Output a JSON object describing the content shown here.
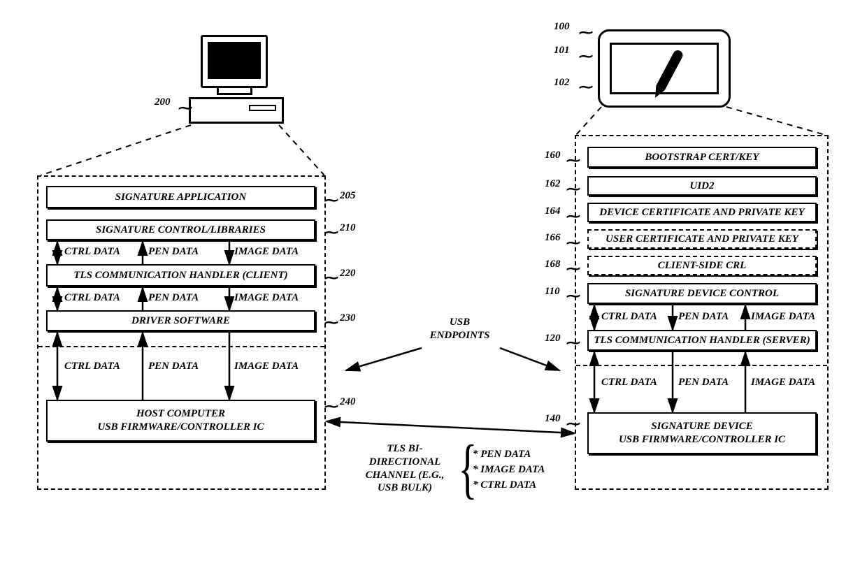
{
  "left": {
    "ref_computer": "200",
    "b205": "SIGNATURE APPLICATION",
    "b210": "SIGNATURE CONTROL/LIBRARIES",
    "b220": "TLS COMMUNICATION HANDLER (CLIENT)",
    "b230": "DRIVER SOFTWARE",
    "b240_l1": "HOST COMPUTER",
    "b240_l2": "USB FIRMWARE/CONTROLLER IC",
    "r205": "205",
    "r210": "210",
    "r220": "220",
    "r230": "230",
    "r240": "240",
    "ctrl": "CTRL DATA",
    "pen": "PEN DATA",
    "image": "IMAGE DATA"
  },
  "right": {
    "ref_tablet": "100",
    "ref_screen": "101",
    "ref_pen": "102",
    "b160": "BOOTSTRAP CERT/KEY",
    "b162": "UID2",
    "b164": "DEVICE CERTIFICATE AND PRIVATE KEY",
    "b166": "USER CERTIFICATE AND PRIVATE KEY",
    "b168": "CLIENT-SIDE CRL",
    "b110": "SIGNATURE DEVICE CONTROL",
    "b120": "TLS COMMUNICATION HANDLER (SERVER)",
    "b140_l1": "SIGNATURE DEVICE",
    "b140_l2": "USB FIRMWARE/CONTROLLER IC",
    "r160": "160",
    "r162": "162",
    "r164": "164",
    "r166": "166",
    "r168": "168",
    "r110": "110",
    "r120": "120",
    "r140": "140",
    "ctrl": "CTRL DATA",
    "pen": "PEN DATA",
    "image": "IMAGE DATA"
  },
  "center": {
    "endpoints": "USB\nENDPOINTS",
    "channel": "TLS BI-\nDIRECTIONAL\nCHANNEL (E.G.,\nUSB BULK)",
    "d1": "* PEN DATA",
    "d2": "* IMAGE DATA",
    "d3": "* CTRL DATA"
  }
}
